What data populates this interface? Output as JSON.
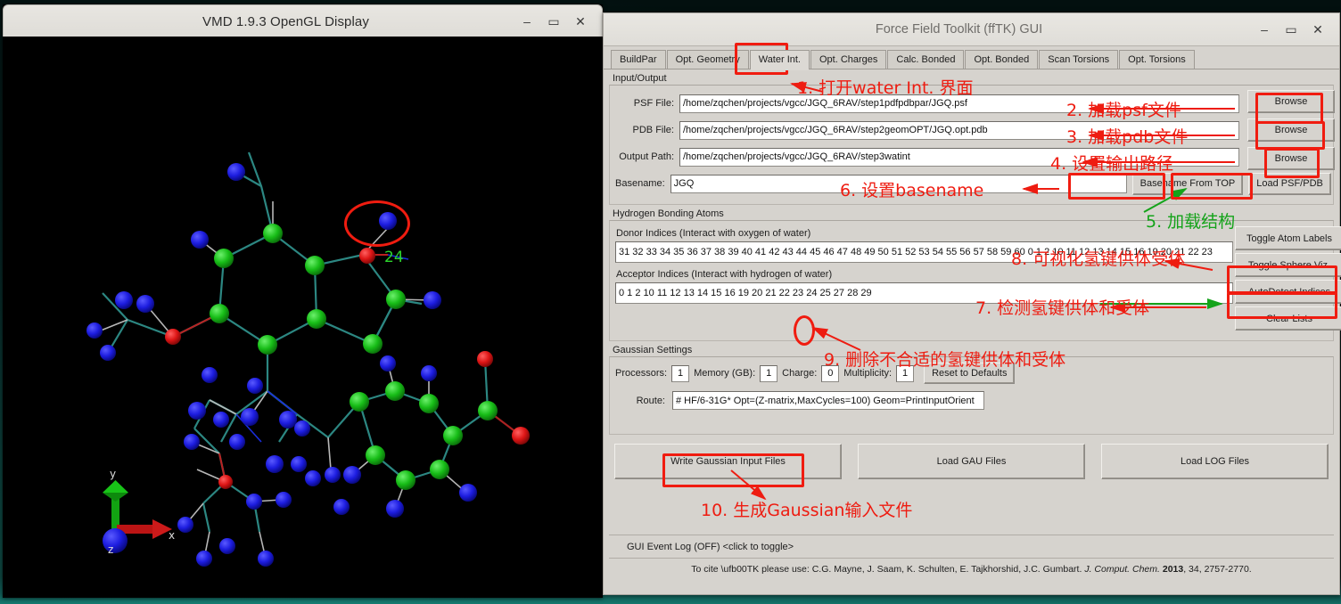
{
  "vmd": {
    "title": "VMD 1.9.3 OpenGL Display",
    "minimize": "–",
    "maximize": "▭",
    "close": "✕",
    "axis_labels": {
      "x": "x",
      "y": "y",
      "z": "z"
    },
    "atom_label": "24"
  },
  "fftk": {
    "title": "Force Field Toolkit (ffTK) GUI",
    "minimize": "–",
    "maximize": "▭",
    "close": "✕",
    "tabs": [
      {
        "label": "BuildPar",
        "active": false
      },
      {
        "label": "Opt. Geometry",
        "active": false
      },
      {
        "label": "Water Int.",
        "active": true
      },
      {
        "label": "Opt. Charges",
        "active": false
      },
      {
        "label": "Calc. Bonded",
        "active": false
      },
      {
        "label": "Opt. Bonded",
        "active": false
      },
      {
        "label": "Scan Torsions",
        "active": false
      },
      {
        "label": "Opt. Torsions",
        "active": false
      }
    ],
    "io": {
      "group_label": "Input/Output",
      "psf_label": "PSF File:",
      "psf_value": "/home/zqchen/projects/vgcc/JGQ_6RAV/step1pdfpdbpar/JGQ.psf",
      "pdb_label": "PDB File:",
      "pdb_value": "/home/zqchen/projects/vgcc/JGQ_6RAV/step2geomOPT/JGQ.opt.pdb",
      "outpath_label": "Output Path:",
      "outpath_value": "/home/zqchen/projects/vgcc/JGQ_6RAV/step3watint",
      "basename_label": "Basename:",
      "basename_value": "JGQ",
      "browse_1": "Browse",
      "browse_2": "Browse",
      "browse_3": "Browse",
      "basename_from_top": "Basename From TOP",
      "load_psf_pdb": "Load PSF/PDB"
    },
    "hbond": {
      "group_label": "Hydrogen Bonding Atoms",
      "donor_caption": "Donor Indices (Interact with oxygen of water)",
      "donor_value": "31 32 33 34 35 36 37 38 39 40 41 42 43 44 45 46 47 48 49 50 51 52 53 54 55 56 57 58 59 60 0 1 2 10 11 12 13 14 15 16 19 20 21 22 23",
      "acceptor_caption": "Acceptor Indices (Interact with hydrogen of water)",
      "acceptor_value": "0 1 2 10 11 12 13 14 15 16 19 20 21 22 23 24 25 27 28 29",
      "toggle_atom_labels": "Toggle Atom Labels",
      "toggle_sphere_viz": "Toggle Sphere Viz.",
      "autodetect_indices": "AutoDetect Indices",
      "clear_lists": "Clear Lists"
    },
    "gaussian": {
      "group_label": "Gaussian Settings",
      "processors_label": "Processors:",
      "processors_value": "1",
      "memory_label": "Memory (GB):",
      "memory_value": "1",
      "charge_label": "Charge:",
      "charge_value": "0",
      "multiplicity_label": "Multiplicity:",
      "multiplicity_value": "1",
      "reset_defaults": "Reset to Defaults",
      "route_label": "Route:",
      "route_value": "# HF/6-31G* Opt=(Z-matrix,MaxCycles=100) Geom=PrintInputOrient"
    },
    "actions": {
      "write_gaussian": "Write Gaussian Input Files",
      "load_gau": "Load GAU Files",
      "load_log": "Load LOG Files"
    },
    "footer": {
      "event_log": "GUI Event Log (OFF) <click to toggle>",
      "cite_prefix": "To cite \\ufb00TK please use:  C.G. Mayne, J. Saam, K. Schulten, E. Tajkhorshid, J.C. Gumbart.",
      "cite_journal": "J. Comput. Chem.",
      "cite_year": "2013",
      "cite_rest": ", 34, 2757-2770."
    }
  },
  "annotations": [
    {
      "id": "a1",
      "text": "1. 打开water Int. 界面",
      "color": "#ee1c11"
    },
    {
      "id": "a2",
      "text": "2. 加载psf文件",
      "color": "#ee1c11"
    },
    {
      "id": "a3",
      "text": "3. 加载pdb文件",
      "color": "#ee1c11"
    },
    {
      "id": "a4",
      "text": "4. 设置输出路径",
      "color": "#ee1c11"
    },
    {
      "id": "a5",
      "text": "5. 加载结构",
      "color": "#14a31a"
    },
    {
      "id": "a6",
      "text": "6. 设置basename",
      "color": "#ee1c11"
    },
    {
      "id": "a7",
      "text": "7. 检测氢键供体和受体",
      "color": "#ee1c11"
    },
    {
      "id": "a8",
      "text": "8. 可视化氢键供体受体",
      "color": "#ee1c11"
    },
    {
      "id": "a9",
      "text": "9. 删除不合适的氢键供体和受体",
      "color": "#ee1c11"
    },
    {
      "id": "a10",
      "text": "10. 生成Gaussian输入文件",
      "color": "#ee1c11"
    }
  ],
  "colors": {
    "annotation_red": "#ee1c11",
    "annotation_green": "#14a31a",
    "carbon_green": "#15b915",
    "nitrogen_blue": "#1a1ad8",
    "oxygen_red": "#d81414",
    "bond_cyan": "#2e8b86",
    "chrome_gray": "#d6d3ce"
  }
}
